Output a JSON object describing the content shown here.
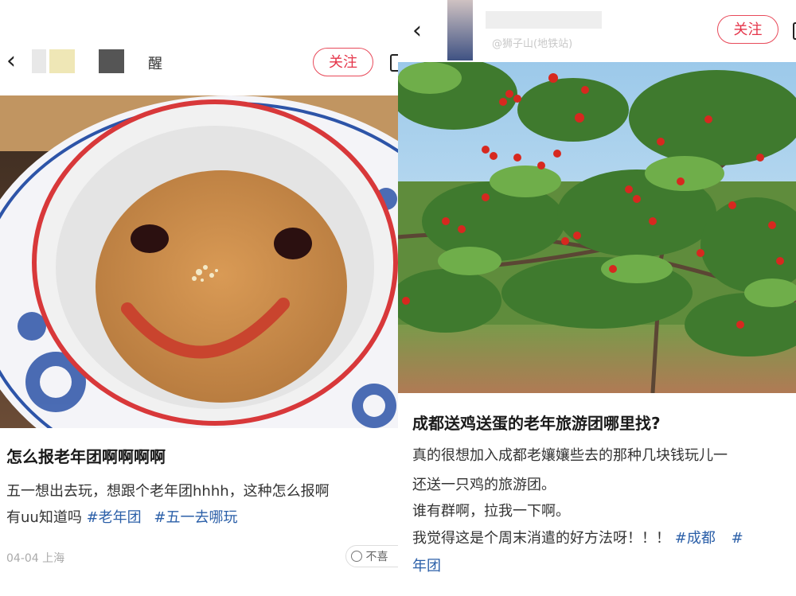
{
  "left_post": {
    "author_name_fragment": "醒",
    "follow_label": "关注",
    "title": "怎么报老年团啊啊啊啊",
    "body_line1": "五一想出去玩，想跟个老年团hhhh，这种怎么报啊",
    "body_line2_text": "有uu知道吗",
    "tags": [
      "#老年团",
      "#五一去哪玩"
    ],
    "date_location": "04-04 上海",
    "dislike_label": "不喜"
  },
  "right_post": {
    "location_text": "@狮子山(地铁站)",
    "follow_label": "关注",
    "title": "成都送鸡送蛋的老年旅游团哪里找?",
    "body_line1": "真的很想加入成都老孃孃些去的那种几块钱玩儿一",
    "body_line2": "还送一只鸡的旅游团。",
    "body_line3": "谁有群啊，拉我一下啊。",
    "body_line4_text": "我觉得这是个周末消遣的好方法呀！！！",
    "tag1": "#成都",
    "tag2_start": "#",
    "tag2_cont": "年团"
  },
  "colors": {
    "accent": "#e5354a",
    "tag": "#2b5fa8"
  },
  "icons": [
    "back-arrow-icon",
    "more-icon",
    "dislike-face-icon"
  ]
}
